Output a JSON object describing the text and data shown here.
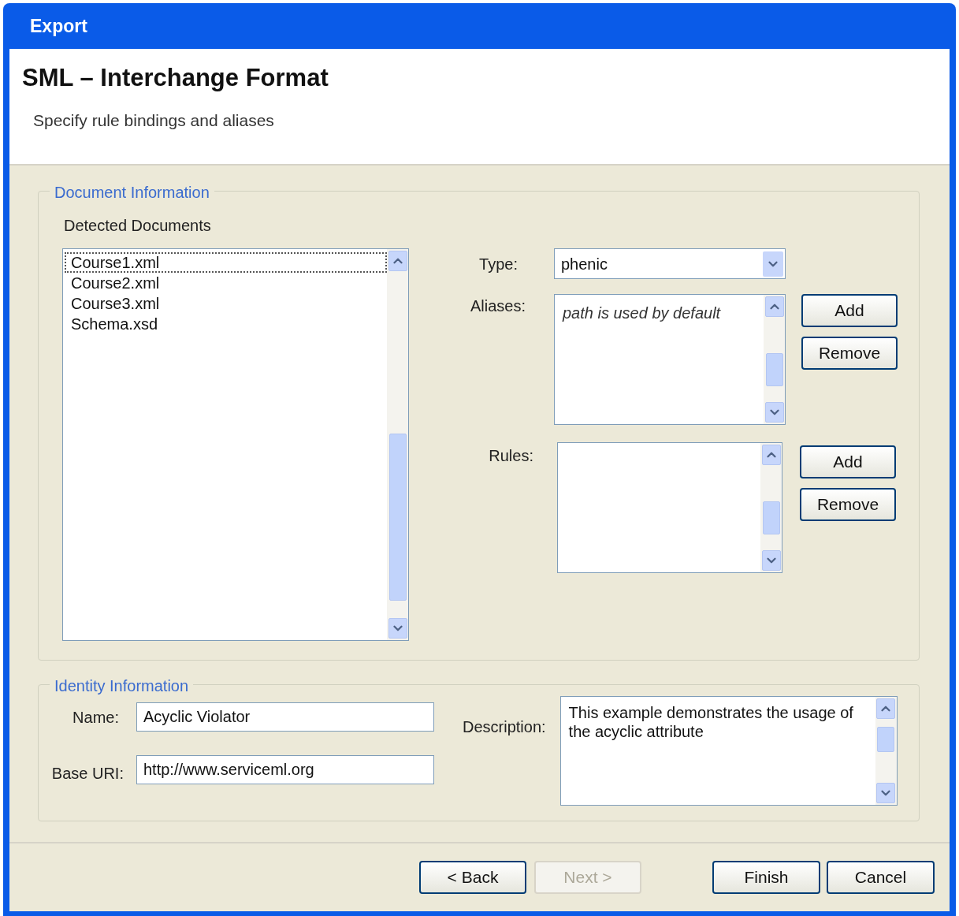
{
  "window": {
    "title": "Export"
  },
  "header": {
    "title": "SML – Interchange Format",
    "subtitle": "Specify rule bindings and aliases"
  },
  "document_information": {
    "legend": "Document Information",
    "detected_label": "Detected Documents",
    "documents": [
      {
        "name": "Course1.xml",
        "focused": true
      },
      {
        "name": "Course2.xml",
        "focused": false
      },
      {
        "name": "Course3.xml",
        "focused": false
      },
      {
        "name": "Schema.xsd",
        "focused": false
      }
    ],
    "type": {
      "label": "Type:",
      "value": "phenic"
    },
    "aliases": {
      "label": "Aliases:",
      "placeholder": "path is used by default",
      "buttons": [
        "Add",
        "Remove"
      ]
    },
    "rules": {
      "label": "Rules:",
      "buttons": [
        "Add",
        "Remove"
      ]
    }
  },
  "identity_information": {
    "legend": "Identity Information",
    "name": {
      "label": "Name:",
      "value": "Acyclic Violator"
    },
    "base_uri": {
      "label": "Base URI:",
      "value": "http://www.serviceml.org"
    },
    "description": {
      "label": "Description:",
      "value": "This example demonstrates the usage of the acyclic attribute"
    }
  },
  "buttons": [
    {
      "label": "< Back",
      "disabled": false
    },
    {
      "label": "Next >",
      "disabled": true
    },
    {
      "label": "Finish",
      "disabled": false
    },
    {
      "label": "Cancel",
      "disabled": false
    }
  ]
}
